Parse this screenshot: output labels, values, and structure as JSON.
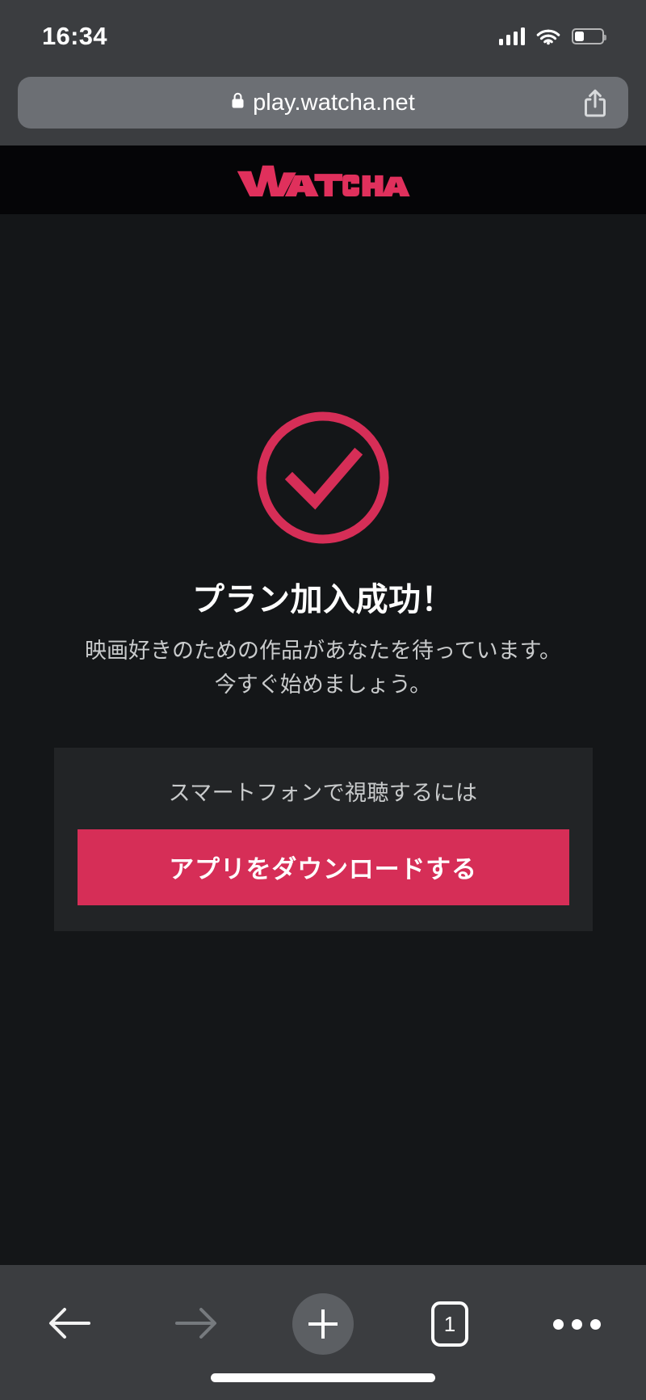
{
  "status_bar": {
    "time": "16:34",
    "signal_icon": "cellular-signal-icon",
    "wifi_icon": "wifi-icon",
    "battery_icon": "battery-icon",
    "battery_level_percent": 35
  },
  "browser": {
    "url": "play.watcha.net",
    "lock_icon": "lock-icon",
    "share_icon": "share-icon",
    "toolbar": {
      "back_label": "back-arrow",
      "forward_label": "forward-arrow",
      "new_tab_label": "+",
      "tab_count": "1",
      "more_label": "more-options"
    }
  },
  "site": {
    "logo_text": "WATCHA",
    "brand_color": "#E0305C"
  },
  "main": {
    "status_icon": "check-circle-icon",
    "accent_color": "#D62E57",
    "headline": "プラン加入成功！",
    "sub_lines": [
      "映画好きのための作品があなたを待っています。",
      "今すぐ始めましょう。"
    ],
    "card": {
      "label": "スマートフォンで視聴するには",
      "button_label": "アプリをダウンロードする",
      "button_color": "#D62E57",
      "background_color": "#222426"
    }
  }
}
